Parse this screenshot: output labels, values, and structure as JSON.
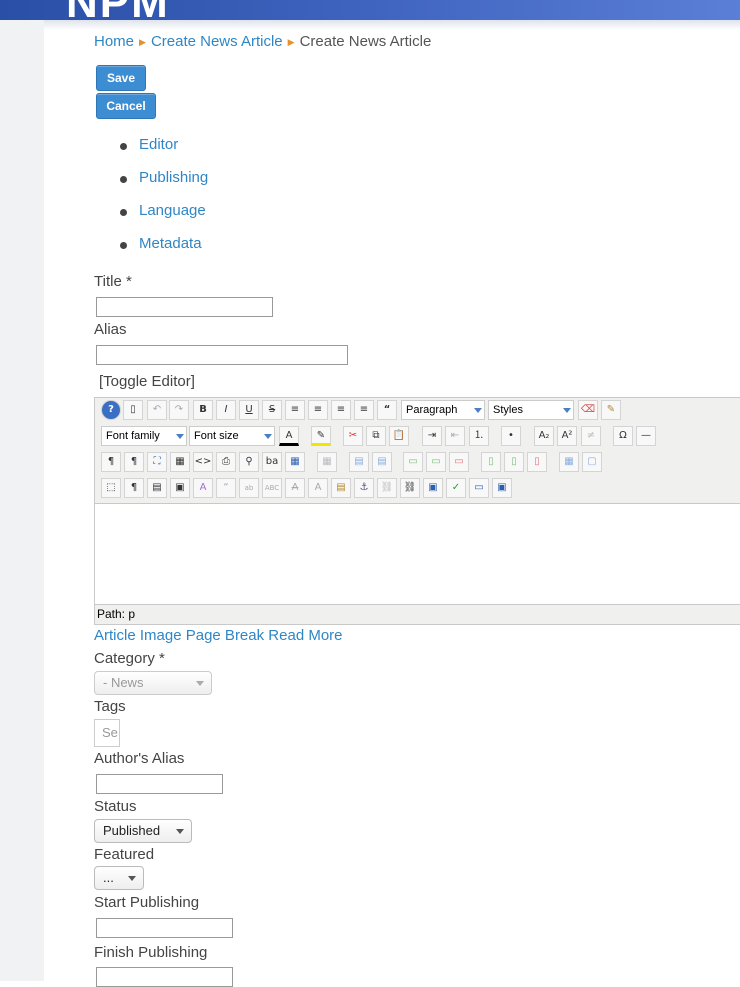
{
  "header": {
    "logo": "NPM"
  },
  "breadcrumb": {
    "home": "Home",
    "parent": "Create News Article",
    "current": "Create News Article"
  },
  "toolbar": {
    "save_label": "Save",
    "cancel_label": "Cancel"
  },
  "tabs": [
    {
      "label": "Editor"
    },
    {
      "label": "Publishing"
    },
    {
      "label": "Language"
    },
    {
      "label": "Metadata"
    }
  ],
  "form": {
    "title_label": "Title *",
    "alias_label": "Alias",
    "toggle_editor": "[Toggle Editor]",
    "editor": {
      "format_select": "Paragraph",
      "styles_select": "Styles",
      "font_family": "Font family",
      "font_size": "Font size",
      "path_text": "Path:  p"
    },
    "editor_buttons": {
      "article": "Article",
      "image": "Image",
      "page_break": "Page Break",
      "read_more": "Read More"
    },
    "category_label": "Category *",
    "category_value": "- News",
    "tags_label": "Tags",
    "tags_placeholder": "Se",
    "author_alias_label": "Author's Alias",
    "status_label": "Status",
    "status_value": "Published",
    "featured_label": "Featured",
    "featured_value": "...",
    "start_publishing_label": "Start Publishing",
    "finish_publishing_label": "Finish Publishing"
  },
  "colors": {
    "link": "#2f86c6",
    "button": "#3d8dd3",
    "header": "#3f64c0",
    "breadcrumb_separator": "#e5912c"
  }
}
